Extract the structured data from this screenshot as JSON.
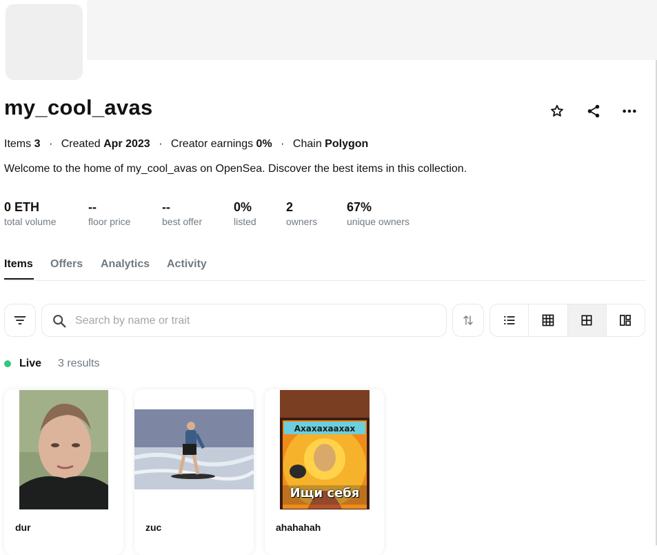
{
  "collection": {
    "title": "my_cool_avas",
    "meta": {
      "items_label": "Items",
      "items_value": "3",
      "created_label": "Created",
      "created_value": "Apr 2023",
      "earnings_label": "Creator earnings",
      "earnings_value": "0%",
      "chain_label": "Chain",
      "chain_value": "Polygon",
      "separator": "·"
    },
    "description": "Welcome to the home of my_cool_avas on OpenSea. Discover the best items in this collection."
  },
  "actions": {
    "favorite_icon": "star-icon",
    "share_icon": "share-icon",
    "more_icon": "more-icon"
  },
  "stats": [
    {
      "value": "0 ETH",
      "label": "total volume"
    },
    {
      "value": "--",
      "label": "floor price"
    },
    {
      "value": "--",
      "label": "best offer"
    },
    {
      "value": "0%",
      "label": "listed"
    },
    {
      "value": "2",
      "label": "owners"
    },
    {
      "value": "67%",
      "label": "unique owners"
    }
  ],
  "tabs": [
    {
      "label": "Items",
      "active": true
    },
    {
      "label": "Offers",
      "active": false
    },
    {
      "label": "Analytics",
      "active": false
    },
    {
      "label": "Activity",
      "active": false
    }
  ],
  "search": {
    "placeholder": "Search by name or trait"
  },
  "status": {
    "live_label": "Live",
    "results": "3 results",
    "live_color": "#34c77b"
  },
  "items": [
    {
      "name": "dur"
    },
    {
      "name": "zuc"
    },
    {
      "name": "ahahahah",
      "image_caption_top": "Ахахахаахах",
      "image_caption_bottom": "Ищи себя"
    }
  ]
}
